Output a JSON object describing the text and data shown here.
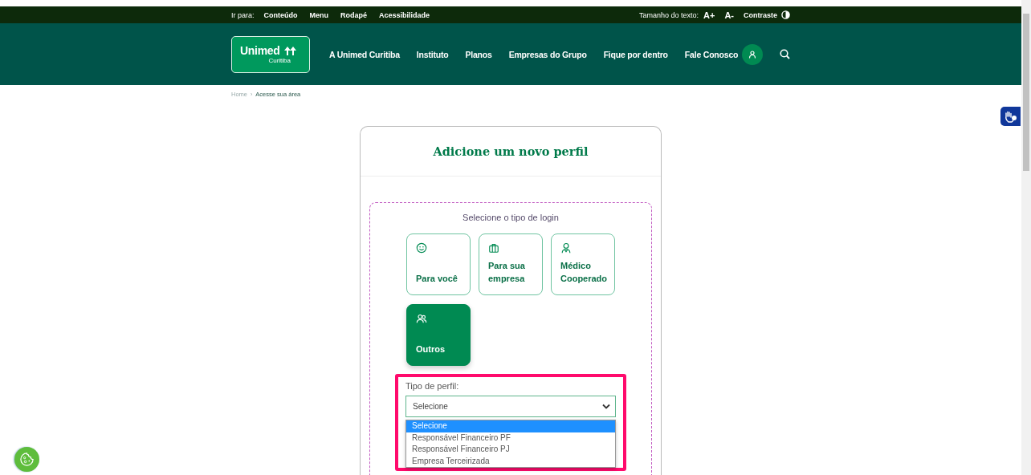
{
  "skip_bar": {
    "label": "Ir para:",
    "links": [
      "Conteúdo",
      "Menu",
      "Rodapé",
      "Acessibilidade"
    ]
  },
  "text_size": {
    "label": "Tamanho do texto:",
    "buttons": [
      "A+",
      "A-"
    ]
  },
  "contrast": {
    "label": "Contraste"
  },
  "logo": {
    "name": "Unimed",
    "city": "Curitiba"
  },
  "nav": [
    "A Unimed Curitiba",
    "Instituto",
    "Planos",
    "Empresas do Grupo",
    "Fique por dentro",
    "Fale Conosco"
  ],
  "breadcrumb": [
    {
      "label": "Home",
      "current": false
    },
    {
      "separator": "›",
      "label": "Acesse sua área",
      "current": true
    }
  ],
  "card": {
    "title": "Adicione um novo perfil",
    "login_prompt": "Selecione o tipo de login",
    "login_types": [
      {
        "label": "Para você",
        "kind": "smile",
        "selected": false
      },
      {
        "label": "Para sua empresa",
        "kind": "briefcase",
        "selected": false
      },
      {
        "label": "Médico Cooperado",
        "kind": "person",
        "selected": false
      },
      {
        "label": "Outros",
        "kind": "people",
        "selected": true
      }
    ],
    "profile_field": {
      "label": "Tipo de perfil:",
      "value": "Selecione",
      "expanded": true,
      "options": [
        {
          "label": "Selecione",
          "selected": true
        },
        {
          "label": "Responsável Financeiro PF",
          "selected": false
        },
        {
          "label": "Responsável Financeiro PJ",
          "selected": false
        },
        {
          "label": "Empresa Terceirizada",
          "selected": false
        }
      ]
    }
  }
}
